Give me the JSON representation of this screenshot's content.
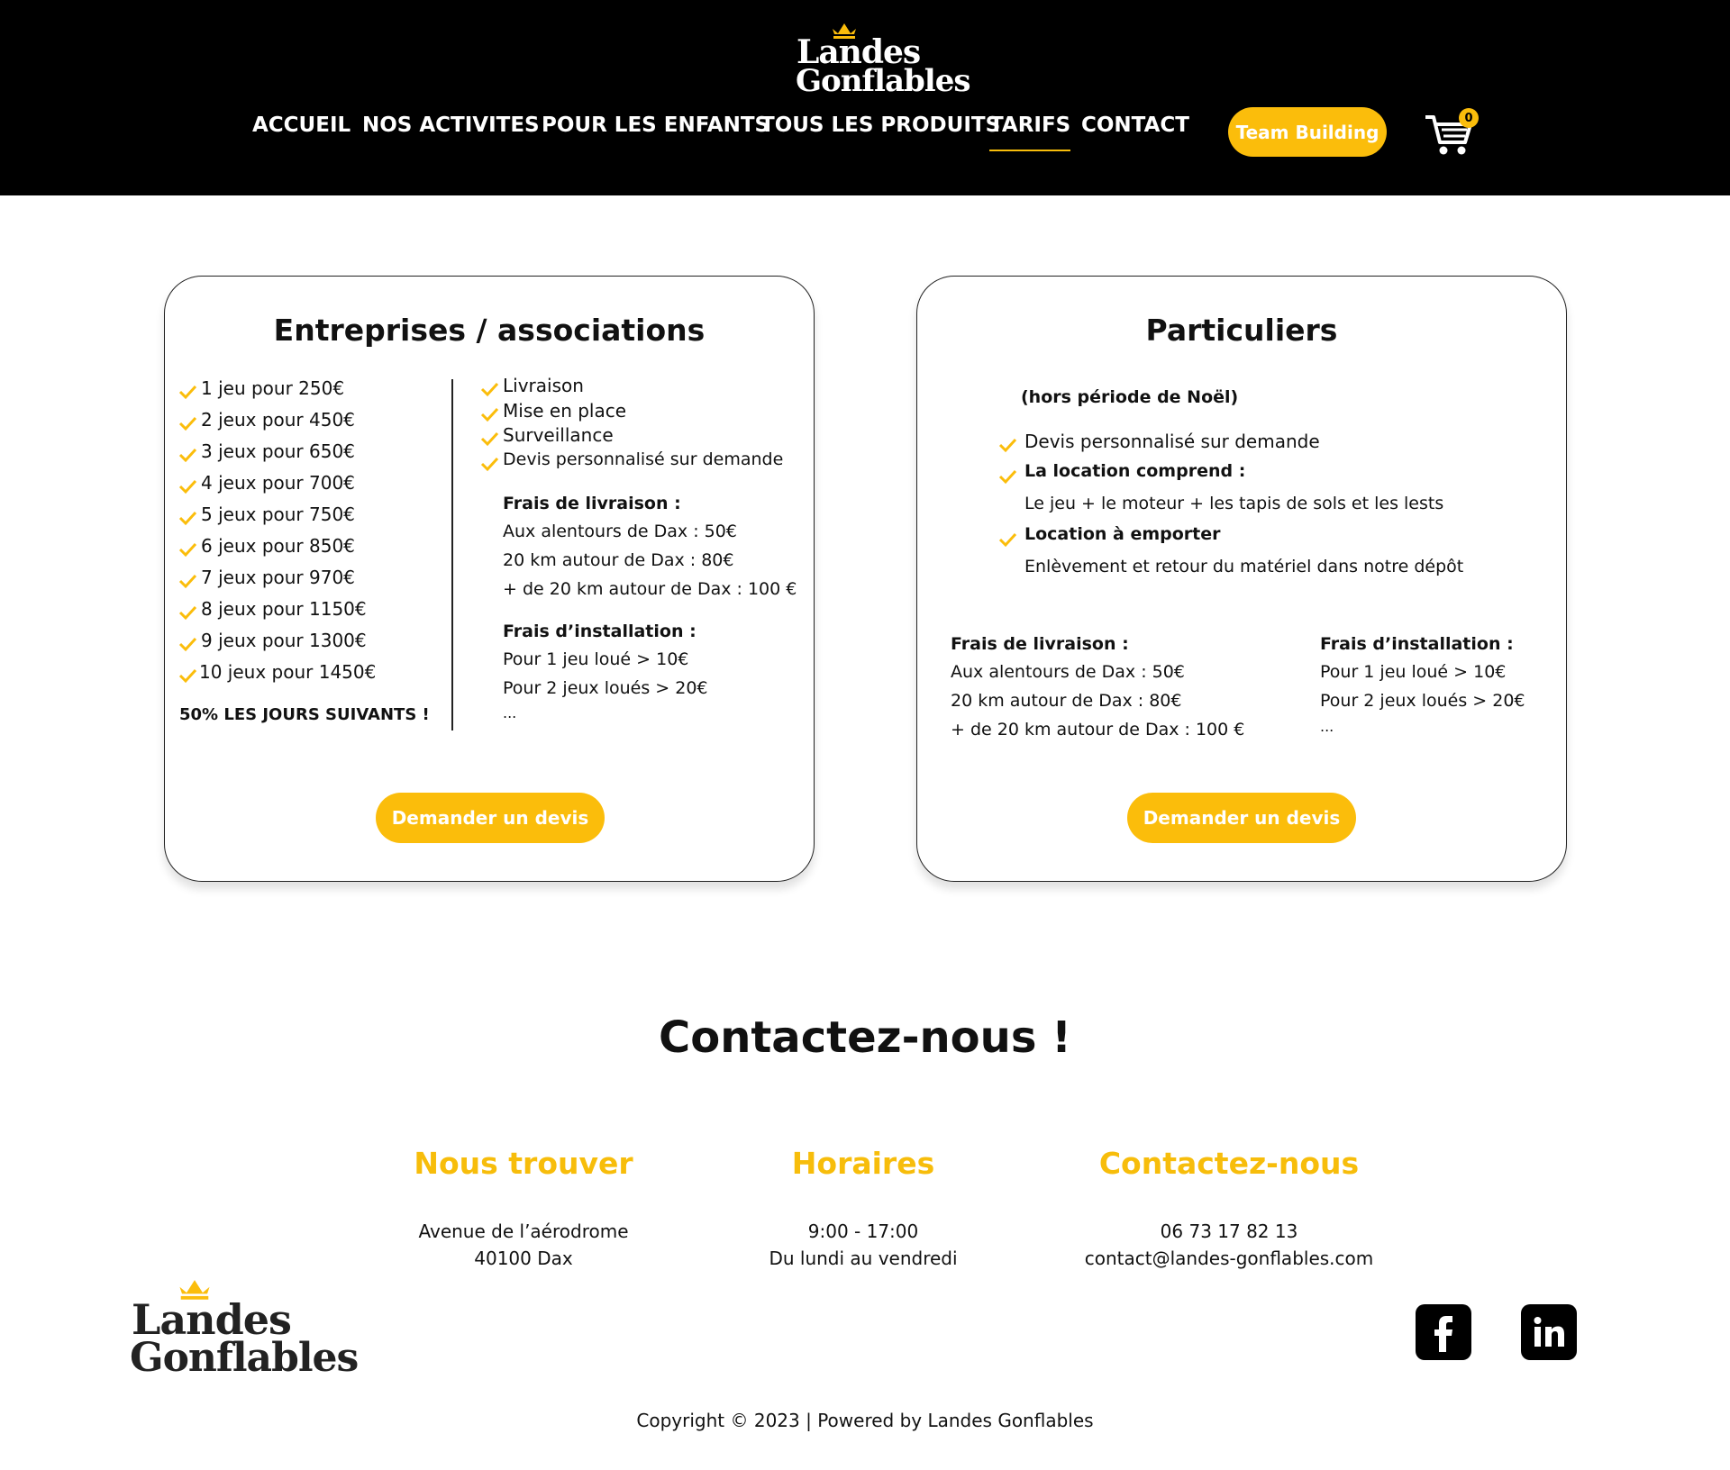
{
  "brand": {
    "line1": "Landes",
    "line2": "Gonflables"
  },
  "nav": {
    "items": [
      "ACCUEIL",
      "NOS ACTIVITES",
      "POUR LES ENFANTS",
      "TOUS LES PRODUITS",
      "TARIFS",
      "CONTACT"
    ],
    "active": "TARIFS",
    "team_building": "Team Building",
    "cart_count": "0"
  },
  "colors": {
    "accent": "#fbbd0b",
    "header_bg": "#000000"
  },
  "card_business": {
    "title": "Entreprises / associations",
    "prices": [
      "1 jeu pour 250€",
      "2 jeux pour 450€",
      "3 jeux pour 650€",
      "4 jeux pour 700€",
      "5 jeux pour 750€",
      "6 jeux pour 850€",
      "7 jeux pour 970€",
      "8 jeux pour 1150€",
      "9 jeux pour 1300€",
      "10 jeux pour 1450€"
    ],
    "discount": "50% LES JOURS SUIVANTS !",
    "services": [
      "Livraison",
      "Mise en place",
      "Surveillance",
      "Devis personnalisé sur demande"
    ],
    "delivery_title": "Frais de livraison :",
    "delivery": [
      "Aux alentours de Dax : 50€",
      "20 km autour de Dax : 80€",
      "+ de 20 km autour de Dax : 100 €"
    ],
    "install_title": "Frais d’installation :",
    "install": [
      "Pour 1 jeu loué > 10€",
      "Pour 2 jeux loués > 20€",
      "..."
    ],
    "button": "Demander un devis"
  },
  "card_private": {
    "title": "Particuliers",
    "subtitle": "(hors période de Noël)",
    "item1": "Devis personnalisé sur demande",
    "item2_title": "La location comprend :",
    "item2_text": "Le jeu + le moteur + les tapis de sols et les lests",
    "item3_title": "Location à emporter",
    "item3_text": "Enlèvement et retour du matériel dans notre dépôt",
    "delivery_title": "Frais de livraison :",
    "delivery": [
      "Aux alentours de Dax : 50€",
      "20 km autour de Dax : 80€",
      "+ de 20 km autour de Dax : 100 €"
    ],
    "install_title": "Frais d’installation :",
    "install": [
      "Pour 1 jeu loué > 10€",
      "Pour 2 jeux loués > 20€",
      "..."
    ],
    "button": "Demander un devis"
  },
  "contact": {
    "title": "Contactez-nous !",
    "find_title": "Nous trouver",
    "find_lines": [
      "Avenue de l’aérodrome",
      "40100 Dax"
    ],
    "hours_title": "Horaires",
    "hours_lines": [
      "9:00 - 17:00",
      "Du lundi au vendredi"
    ],
    "reach_title": "Contactez-nous",
    "reach_lines": [
      "06 73 17 82 13",
      "contact@landes-gonflables.com"
    ]
  },
  "social": {
    "facebook_icon": "facebook-icon",
    "linkedin_icon": "linkedin-icon"
  },
  "footer": {
    "copyright": "Copyright © 2023 | Powered by Landes Gonflables"
  }
}
